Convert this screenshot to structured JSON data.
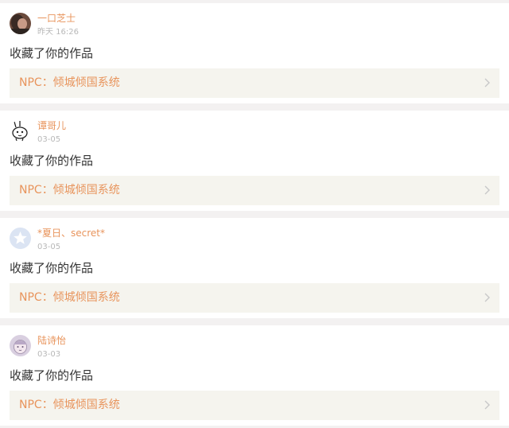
{
  "colors": {
    "accent": "#e8945c",
    "page_background": "#f3f1f1",
    "card_background": "#ffffff",
    "link_background": "#f5f4ee",
    "timestamp": "#b8b8b8",
    "body_text": "#333333"
  },
  "notifications": [
    {
      "username": "一口芝士",
      "timestamp": "昨天 16:26",
      "action": "收藏了你的作品",
      "work_title": "NPC：倾城倾国系统",
      "avatar_icon": "photo-avatar-icon"
    },
    {
      "username": "谭哥儿",
      "timestamp": "03-05",
      "action": "收藏了你的作品",
      "work_title": "NPC：倾城倾国系统",
      "avatar_icon": "bunny-avatar-icon"
    },
    {
      "username": "*夏日、secret*",
      "timestamp": "03-05",
      "action": "收藏了你的作品",
      "work_title": "NPC：倾城倾国系统",
      "avatar_icon": "default-star-avatar-icon"
    },
    {
      "username": "陆诗怡",
      "timestamp": "03-03",
      "action": "收藏了你的作品",
      "work_title": "NPC：倾城倾国系统",
      "avatar_icon": "cartoon-avatar-icon"
    }
  ]
}
